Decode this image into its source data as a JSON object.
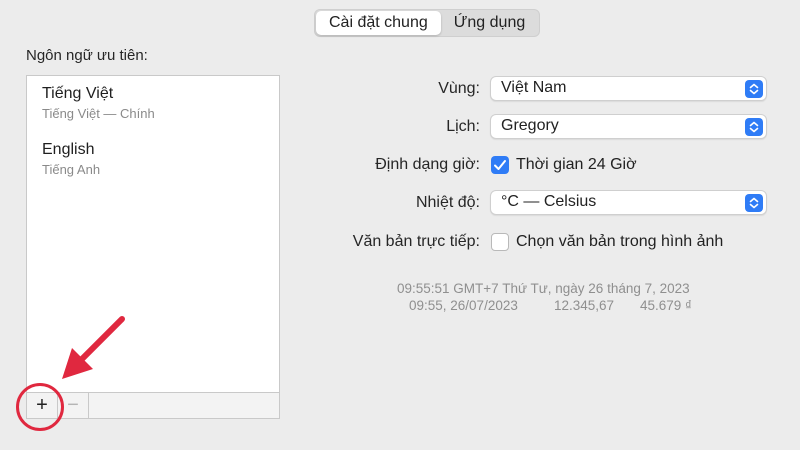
{
  "tabs": [
    {
      "label": "Cài đặt chung",
      "active": true
    },
    {
      "label": "Ứng dụng",
      "active": false
    }
  ],
  "languages": {
    "title": "Ngôn ngữ ưu tiên:",
    "items": [
      {
        "name": "Tiếng Việt",
        "subtitle": "Tiếng Việt — Chính"
      },
      {
        "name": "English",
        "subtitle": "Tiếng Anh"
      }
    ],
    "toolbar": {
      "add": "+",
      "remove": "−"
    }
  },
  "settings": {
    "region": {
      "label": "Vùng:",
      "value": "Việt Nam"
    },
    "calendar": {
      "label": "Lịch:",
      "value": "Gregory"
    },
    "time_format": {
      "label": "Định dạng giờ:",
      "option": "Thời gian 24 Giờ",
      "checked": true
    },
    "temperature": {
      "label": "Nhiệt độ:",
      "value": "°C — Celsius"
    },
    "live_text": {
      "label": "Văn bản trực tiếp:",
      "option": "Chọn văn bản trong hình ảnh",
      "checked": false
    }
  },
  "preview": {
    "line1": "09:55:51 GMT+7 Thứ Tư, ngày 26 tháng 7, 2023",
    "line2_date": "09:55, 26/07/2023",
    "line2_number": "12.345,67",
    "line2_currency": "45.679 ₫"
  },
  "colors": {
    "accent": "#2f7cf6",
    "highlight": "#e0283f"
  }
}
